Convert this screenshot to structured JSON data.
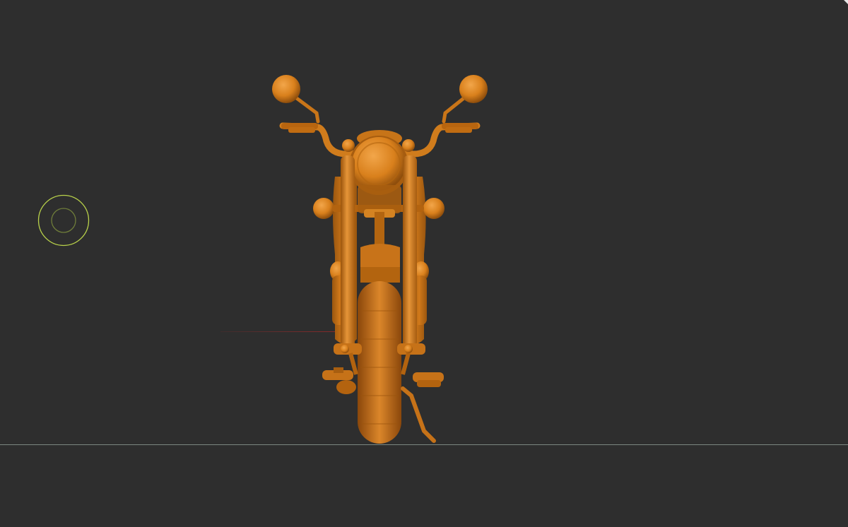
{
  "viewport": {
    "background": "#2e2e2e",
    "model_color": "#d9801c",
    "ground_line_color": "#8a968e",
    "axis_color": "#8a2a2a",
    "gizmo_color": "#b9d24a"
  },
  "scene": {
    "object": "motorcycle",
    "view": "front"
  }
}
